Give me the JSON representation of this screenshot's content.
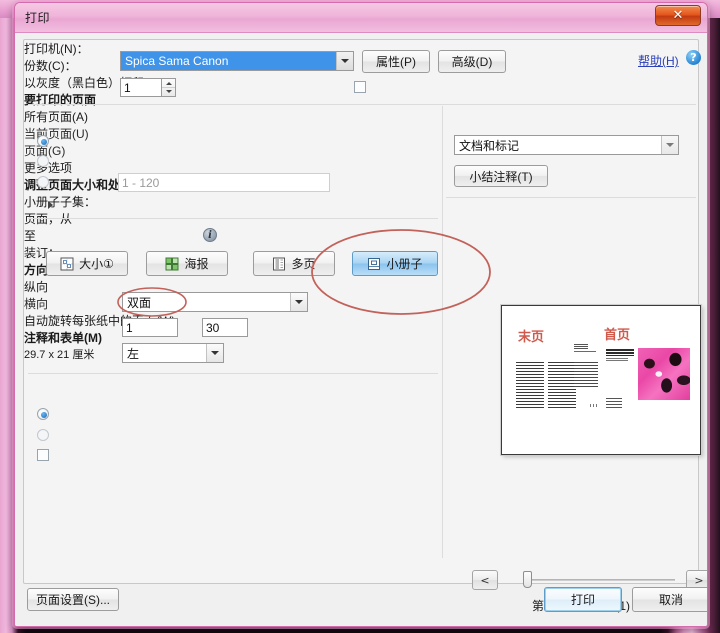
{
  "window": {
    "title": "打印",
    "close_label": "✕"
  },
  "printer": {
    "label": "打印机(N)：",
    "label_text": "打印机",
    "label_accel": "(N)",
    "value": "Spica Sama Canon",
    "properties_button": "属性(P)",
    "advanced_button": "高级(D)",
    "help_link": "帮助(H)",
    "help_icon": "question-icon"
  },
  "copies": {
    "label": "份数(C)：",
    "value": "1",
    "grayscale_checkbox": "以灰度（黑白色）打印(Y)",
    "grayscale_checked": false
  },
  "pages_to_print": {
    "group_title": "要打印的页面",
    "options": [
      {
        "label": "所有页面(A)",
        "selected": true
      },
      {
        "label": "当前页面(U)",
        "selected": false
      },
      {
        "label": "页面(G)",
        "selected": false
      }
    ],
    "range_placeholder": "1 - 120",
    "more_options": "更多选项"
  },
  "page_sizing": {
    "group_title": "调整页面大小和处理页面",
    "info_icon": "info-icon",
    "buttons": [
      {
        "label": "大小①",
        "icon": "size-icon",
        "selected": false
      },
      {
        "label": "海报",
        "icon": "poster-icon",
        "selected": false
      },
      {
        "label": "多页",
        "icon": "multipage-icon",
        "selected": false
      },
      {
        "label": "小册子",
        "icon": "booklet-icon",
        "selected": true
      }
    ],
    "booklet_subset_label": "小册子子集：",
    "booklet_subset_value": "双面",
    "pages_from_label": "页面，从",
    "pages_from_value": "1",
    "pages_to_label": "至",
    "pages_to_value": "30",
    "binding_label": "装订：",
    "binding_value": "左"
  },
  "orientation": {
    "group_title": "方向：",
    "options": [
      {
        "label": "纵向",
        "selected": true
      },
      {
        "label": "横向",
        "selected": false
      }
    ],
    "auto_rotate_label": "自动旋转每张纸中的页面(W)",
    "auto_rotate_checked": false
  },
  "comments_forms": {
    "group_title": "注释和表单(M)",
    "value": "文档和标记",
    "summarize_button": "小结注释(T)"
  },
  "preview": {
    "dimensions": "29.7 x 21 厘米",
    "page_left_label": "末页",
    "page_right_label": "首页",
    "prev_button": "<",
    "next_button": ">",
    "page_status": "第1页，共60页 (1)"
  },
  "footer": {
    "page_setup_button": "页面设置(S)...",
    "print_button": "打印",
    "cancel_button": "取消"
  },
  "annotations": {
    "ellipse_booklet": "red-ellipse-annotation",
    "ellipse_subset": "red-ellipse-annotation"
  },
  "colors": {
    "title_pink": "#efb4da",
    "accent_blue": "#3f93e8",
    "annotation_red": "#c2625a",
    "close_red": "#e4571f"
  }
}
